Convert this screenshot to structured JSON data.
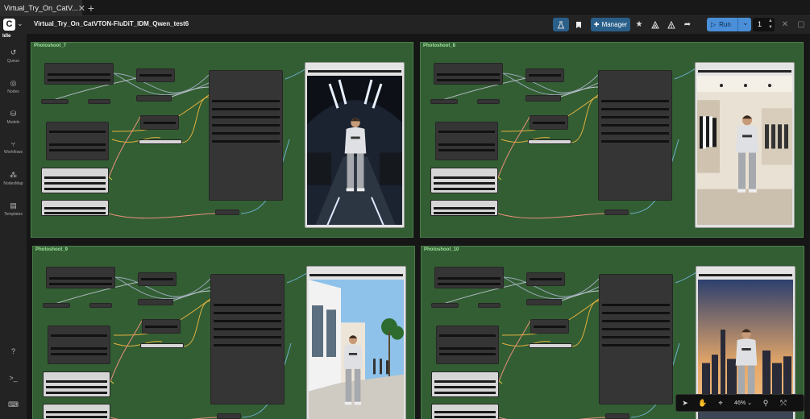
{
  "tab": {
    "title": "Virtual_Try_On_CatV...",
    "close": "✕",
    "new": "+"
  },
  "topbar": {
    "workflow_name": "Virtual_Try_On_CatVTON-FluDiT_IDM_Qwen_test6",
    "manager_label": "Manager",
    "run_label": "Run",
    "queue_count": "1"
  },
  "sidebar": {
    "status": "Idle",
    "items": [
      {
        "label": "Queue",
        "icon": "history-icon"
      },
      {
        "label": "Nodes",
        "icon": "eye-icon"
      },
      {
        "label": "Models",
        "icon": "models-icon"
      },
      {
        "label": "Workflows",
        "icon": "workflows-icon"
      },
      {
        "label": "NodesMap",
        "icon": "nodesmap-icon"
      },
      {
        "label": "Templates",
        "icon": "templates-icon"
      }
    ]
  },
  "groups": [
    {
      "title": "Photoshoot_7",
      "scene": "runway"
    },
    {
      "title": "Photoshoot_8",
      "scene": "store"
    },
    {
      "title": "Photoshoot_9",
      "scene": "street"
    },
    {
      "title": "Photoshoot_10",
      "scene": "city"
    }
  ],
  "canvas_toolbar": {
    "zoom": "46%"
  },
  "colors": {
    "accent": "#2a5f8a",
    "run": "#4a8fd8",
    "group": "#335e33"
  }
}
